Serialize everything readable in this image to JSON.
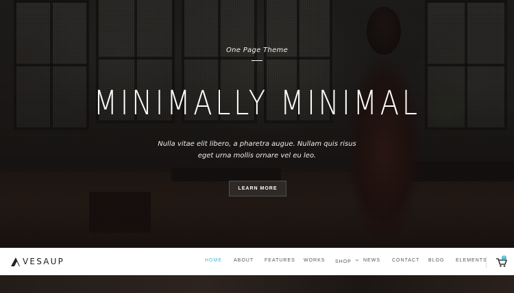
{
  "hero": {
    "kicker": "One Page Theme",
    "headline": "MINIMALLY MINIMAL",
    "subtitle_line1": "Nulla vitae elit libero, a pharetra augue. Nullam quis risus",
    "subtitle_line2": "eget urna mollis ornare vel eu leo.",
    "cta_label": "LEARN MORE"
  },
  "brand": {
    "name": "VESAUP",
    "logo_icon": "triangle-logo-icon"
  },
  "nav": {
    "items": [
      {
        "label": "HOME",
        "active": true
      },
      {
        "label": "ABOUT",
        "active": false
      },
      {
        "label": "FEATURES",
        "active": false
      },
      {
        "label": "WORKS",
        "active": false
      },
      {
        "label": "SHOP",
        "active": false,
        "has_dropdown": true
      },
      {
        "label": "NEWS",
        "active": false
      },
      {
        "label": "CONTACT",
        "active": false
      },
      {
        "label": "BLOG",
        "active": false
      },
      {
        "label": "ELEMENTS",
        "active": false
      }
    ],
    "cart_icon": "shopping-cart-icon",
    "cart_count": "0"
  },
  "colors": {
    "accent": "#3fb8d0",
    "nav_text": "#555555",
    "hero_overlay": "#0c0a0a"
  }
}
